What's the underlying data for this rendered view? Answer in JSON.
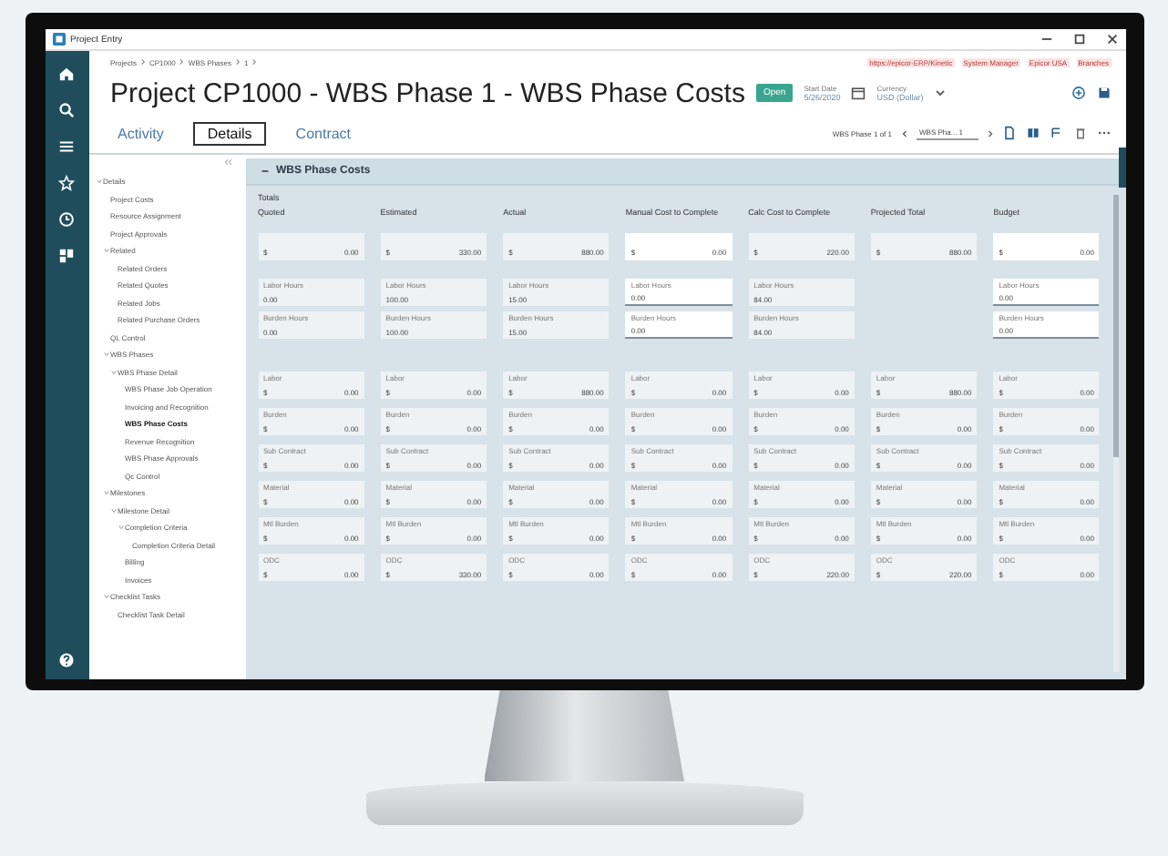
{
  "window": {
    "title": "Project Entry"
  },
  "breadcrumb": [
    "Projects",
    "CP1000",
    "WBS Phases",
    "1"
  ],
  "header_links": [
    "https://epicor-ERP/Kinetic",
    "System Manager",
    "Epicor USA",
    "Branches"
  ],
  "page_title": "Project CP1000 - WBS Phase 1 - WBS Phase Costs",
  "status_badge": "Open",
  "start_date": {
    "label": "Start Date",
    "value": "5/26/2020"
  },
  "currency": {
    "label": "Currency",
    "value": "USD (Dollar)"
  },
  "tabs": [
    {
      "label": "Activity",
      "selected": false
    },
    {
      "label": "Details",
      "selected": true
    },
    {
      "label": "Contract",
      "selected": false
    }
  ],
  "record_nav": {
    "label": "WBS Phase 1 of 1",
    "selector": "WBS Pha... 1"
  },
  "tree_items": [
    {
      "label": "Details",
      "selected": false,
      "children": [
        {
          "label": "Project Costs",
          "selected": false
        },
        {
          "label": "Resource Assignment",
          "selected": false
        },
        {
          "label": "Project Approvals",
          "selected": false
        },
        {
          "label": "Related",
          "selected": false,
          "children": [
            {
              "label": "Related Orders",
              "selected": false
            },
            {
              "label": "Related Quotes",
              "selected": false
            },
            {
              "label": "Related Jobs",
              "selected": false
            },
            {
              "label": "Related Purchase Orders",
              "selected": false
            }
          ]
        },
        {
          "label": "QL Control",
          "selected": false
        },
        {
          "label": "WBS Phases",
          "selected": false,
          "children": [
            {
              "label": "WBS Phase Detail",
              "selected": false,
              "children": [
                {
                  "label": "WBS Phase Job Operation",
                  "selected": false
                },
                {
                  "label": "Invoicing and Recognition",
                  "selected": false
                },
                {
                  "label": "WBS Phase Costs",
                  "selected": true
                },
                {
                  "label": "Revenue Recognition",
                  "selected": false
                },
                {
                  "label": "WBS Phase Approvals",
                  "selected": false
                },
                {
                  "label": "Qc Control",
                  "selected": false
                }
              ]
            }
          ]
        },
        {
          "label": "Milestones",
          "selected": false,
          "children": [
            {
              "label": "Milestone Detail",
              "selected": false,
              "children": [
                {
                  "label": "Completion Criteria",
                  "selected": false,
                  "children": [
                    {
                      "label": "Completion Criteria Detail",
                      "selected": false
                    }
                  ]
                },
                {
                  "label": "Billing",
                  "selected": false
                },
                {
                  "label": "Invoices",
                  "selected": false
                }
              ]
            }
          ]
        },
        {
          "label": "Checklist Tasks",
          "selected": false,
          "children": [
            {
              "label": "Checklist Task Detail",
              "selected": false
            }
          ]
        }
      ]
    }
  ],
  "panel": {
    "title": "WBS Phase Costs",
    "section": "Totals"
  },
  "columns": [
    {
      "title": "Quoted",
      "total": {
        "symbol": "$",
        "value": "0.00"
      },
      "editable": false,
      "hours": [
        {
          "label": "Labor Hours",
          "value": "0.00"
        },
        {
          "label": "Burden Hours",
          "value": "0.00"
        }
      ],
      "costs": [
        {
          "label": "Labor",
          "symbol": "$",
          "value": "0.00"
        },
        {
          "label": "Burden",
          "symbol": "$",
          "value": "0.00"
        },
        {
          "label": "Sub Contract",
          "symbol": "$",
          "value": "0.00"
        },
        {
          "label": "Material",
          "symbol": "$",
          "value": "0.00"
        },
        {
          "label": "Mtl Burden",
          "symbol": "$",
          "value": "0.00"
        },
        {
          "label": "ODC",
          "symbol": "$",
          "value": "0.00"
        }
      ]
    },
    {
      "title": "Estimated",
      "total": {
        "symbol": "$",
        "value": "330.00"
      },
      "editable": false,
      "hours": [
        {
          "label": "Labor Hours",
          "value": "100.00"
        },
        {
          "label": "Burden Hours",
          "value": "100.00"
        }
      ],
      "costs": [
        {
          "label": "Labor",
          "symbol": "$",
          "value": "0.00"
        },
        {
          "label": "Burden",
          "symbol": "$",
          "value": "0.00"
        },
        {
          "label": "Sub Contract",
          "symbol": "$",
          "value": "0.00"
        },
        {
          "label": "Material",
          "symbol": "$",
          "value": "0.00"
        },
        {
          "label": "Mtl Burden",
          "symbol": "$",
          "value": "0.00"
        },
        {
          "label": "ODC",
          "symbol": "$",
          "value": "330.00"
        }
      ]
    },
    {
      "title": "Actual",
      "total": {
        "symbol": "$",
        "value": "880.00"
      },
      "editable": false,
      "hours": [
        {
          "label": "Labor Hours",
          "value": "15.00"
        },
        {
          "label": "Burden Hours",
          "value": "15.00"
        }
      ],
      "costs": [
        {
          "label": "Labor",
          "symbol": "$",
          "value": "880.00"
        },
        {
          "label": "Burden",
          "symbol": "$",
          "value": "0.00"
        },
        {
          "label": "Sub Contract",
          "symbol": "$",
          "value": "0.00"
        },
        {
          "label": "Material",
          "symbol": "$",
          "value": "0.00"
        },
        {
          "label": "Mtl Burden",
          "symbol": "$",
          "value": "0.00"
        },
        {
          "label": "ODC",
          "symbol": "$",
          "value": "0.00"
        }
      ]
    },
    {
      "title": "Manual Cost to Complete",
      "total": {
        "symbol": "$",
        "value": "0.00"
      },
      "editable": true,
      "hours": [
        {
          "label": "Labor Hours",
          "value": "0.00"
        },
        {
          "label": "Burden Hours",
          "value": "0.00"
        }
      ],
      "costs": [
        {
          "label": "Labor",
          "symbol": "$",
          "value": "0.00"
        },
        {
          "label": "Burden",
          "symbol": "$",
          "value": "0.00"
        },
        {
          "label": "Sub Contract",
          "symbol": "$",
          "value": "0.00"
        },
        {
          "label": "Material",
          "symbol": "$",
          "value": "0.00"
        },
        {
          "label": "Mtl Burden",
          "symbol": "$",
          "value": "0.00"
        },
        {
          "label": "ODC",
          "symbol": "$",
          "value": "0.00"
        }
      ]
    },
    {
      "title": "Calc Cost to Complete",
      "total": {
        "symbol": "$",
        "value": "220.00"
      },
      "editable": false,
      "hours": [
        {
          "label": "Labor Hours",
          "value": "84.00"
        },
        {
          "label": "Burden Hours",
          "value": "84.00"
        }
      ],
      "costs": [
        {
          "label": "Labor",
          "symbol": "$",
          "value": "0.00"
        },
        {
          "label": "Burden",
          "symbol": "$",
          "value": "0.00"
        },
        {
          "label": "Sub Contract",
          "symbol": "$",
          "value": "0.00"
        },
        {
          "label": "Material",
          "symbol": "$",
          "value": "0.00"
        },
        {
          "label": "Mtl Burden",
          "symbol": "$",
          "value": "0.00"
        },
        {
          "label": "ODC",
          "symbol": "$",
          "value": "220.00"
        }
      ]
    },
    {
      "title": "Projected Total",
      "total": {
        "symbol": "$",
        "value": "880.00"
      },
      "editable": false,
      "costs": [
        {
          "label": "Labor",
          "symbol": "$",
          "value": "880.00"
        },
        {
          "label": "Burden",
          "symbol": "$",
          "value": "0.00"
        },
        {
          "label": "Sub Contract",
          "symbol": "$",
          "value": "0.00"
        },
        {
          "label": "Material",
          "symbol": "$",
          "value": "0.00"
        },
        {
          "label": "Mtl Burden",
          "symbol": "$",
          "value": "0.00"
        },
        {
          "label": "ODC",
          "symbol": "$",
          "value": "220.00"
        }
      ]
    },
    {
      "title": "Budget",
      "total": {
        "symbol": "$",
        "value": "0.00"
      },
      "editable": true,
      "hours": [
        {
          "label": "Labor Hours",
          "value": "0.00"
        },
        {
          "label": "Burden Hours",
          "value": "0.00"
        }
      ],
      "costs": [
        {
          "label": "Labor",
          "symbol": "$",
          "value": "0.00"
        },
        {
          "label": "Burden",
          "symbol": "$",
          "value": "0.00"
        },
        {
          "label": "Sub Contract",
          "symbol": "$",
          "value": "0.00"
        },
        {
          "label": "Material",
          "symbol": "$",
          "value": "0.00"
        },
        {
          "label": "Mtl Burden",
          "symbol": "$",
          "value": "0.00"
        },
        {
          "label": "ODC",
          "symbol": "$",
          "value": "0.00"
        }
      ]
    }
  ]
}
